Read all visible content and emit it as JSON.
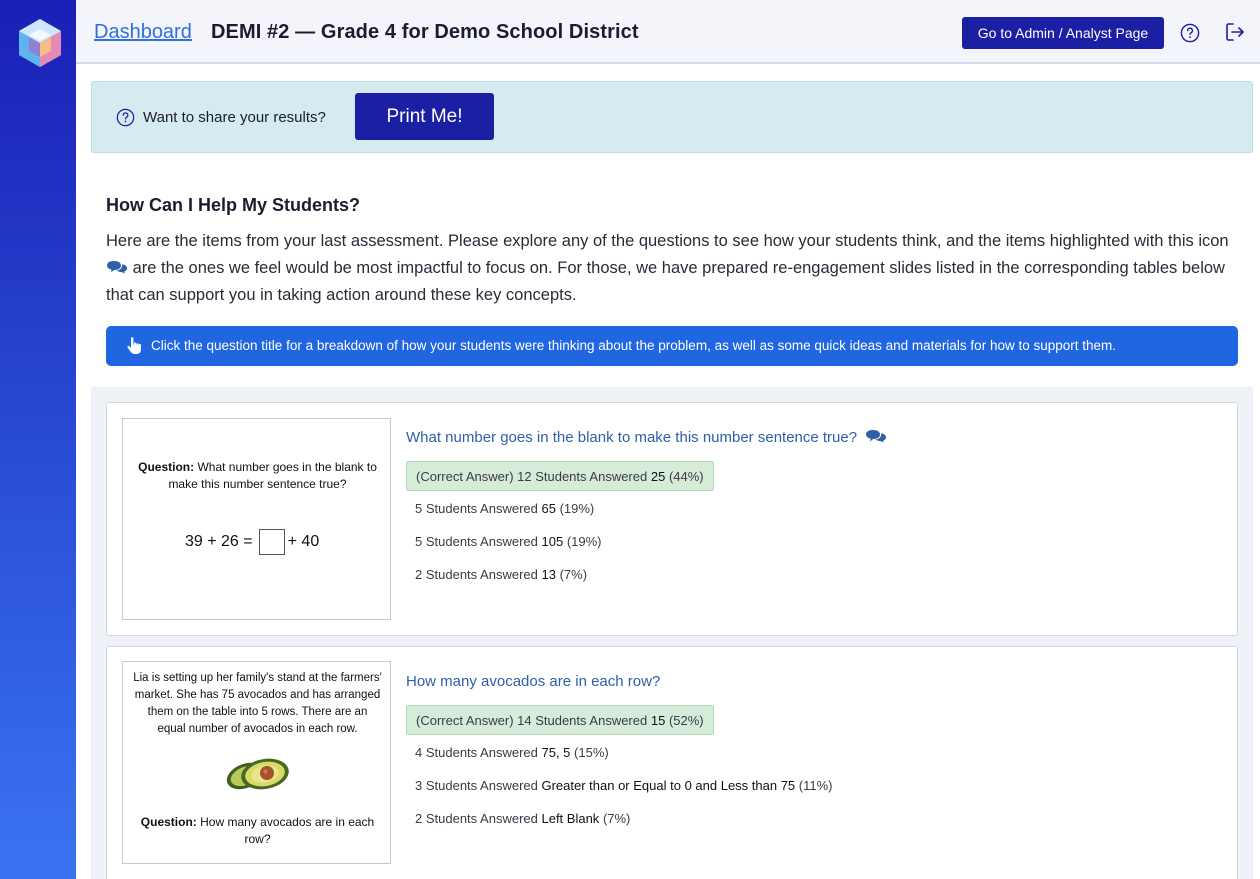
{
  "header": {
    "dashboard_link": "Dashboard",
    "title": "DEMI #2 — Grade 4 for Demo School District",
    "admin_button": "Go to Admin / Analyst Page"
  },
  "share": {
    "text": "Want to share your results?",
    "print_button": "Print Me!"
  },
  "help": {
    "title": "How Can I Help My Students?",
    "para_part1": "Here are the items from your last assessment. Please explore any of the questions to see how your students think, and the items highlighted with this icon",
    "para_part2": "are the ones we feel would be most impactful to focus on. For those, we have prepared re-engagement slides listed in the corresponding tables below that can support you in taking action around these key concepts."
  },
  "info_bar": "Click the question title for a breakdown of how your students were thinking about the problem, as well as some quick ideas and materials for how to support them.",
  "items": [
    {
      "thumb": {
        "question_label": "Question:",
        "question_body": "What number goes in the blank to make this number sentence true?",
        "eq_left": "39 + 26 =",
        "eq_right": "+ 40"
      },
      "title": "What number goes in the blank to make this number sentence true?",
      "answers": [
        {
          "prefix": "(Correct Answer) 12 Students Answered",
          "value": "25",
          "pct": "(44%)"
        },
        {
          "prefix": "5 Students Answered",
          "value": "65",
          "pct": "(19%)"
        },
        {
          "prefix": "5 Students Answered",
          "value": "105",
          "pct": "(19%)"
        },
        {
          "prefix": "2 Students Answered",
          "value": "13",
          "pct": "(7%)"
        }
      ]
    },
    {
      "thumb": {
        "story": "Lia is setting up her family's stand at the farmers' market. She has 75 avocados and has arranged them on the table into 5 rows. There are an equal number of avocados in each row.",
        "question_label": "Question:",
        "question_body": "How many avocados are in each row?"
      },
      "title": "How many avocados are in each row?",
      "answers": [
        {
          "prefix": "(Correct Answer) 14 Students Answered",
          "value": "15",
          "pct": "(52%)"
        },
        {
          "prefix": "4 Students Answered",
          "value": "75, 5",
          "pct": "(15%)"
        },
        {
          "prefix": "3 Students Answered",
          "value": "Greater than or Equal to 0 and Less than 75",
          "pct": "(11%)"
        },
        {
          "prefix": "2 Students Answered",
          "value": "Left Blank",
          "pct": "(7%)"
        }
      ]
    }
  ],
  "colors": {
    "primary": "#1a1fa3",
    "link": "#2f6fe0",
    "info_bar": "#1f66e0",
    "correct_bg": "#d7ecd8",
    "banner_bg": "#d4ecef"
  }
}
